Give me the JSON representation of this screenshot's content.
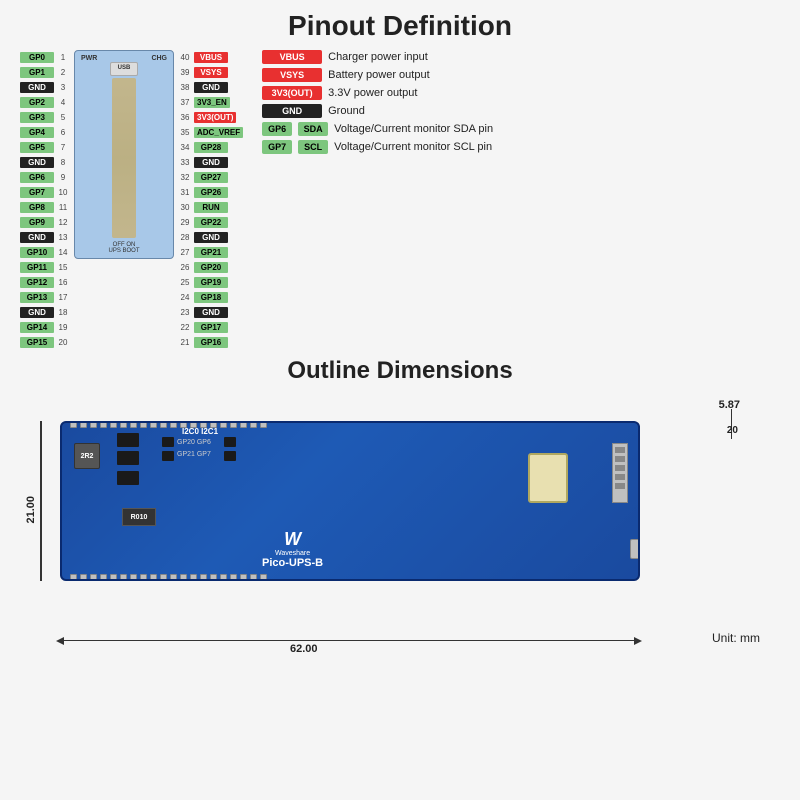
{
  "page": {
    "background": "#f0f0f0"
  },
  "pinout_section": {
    "title": "Pinout Definition",
    "left_pins": [
      {
        "label": "GP0",
        "num": "1",
        "type": "green"
      },
      {
        "label": "GP1",
        "num": "2",
        "type": "green"
      },
      {
        "label": "GND",
        "num": "3",
        "type": "black"
      },
      {
        "label": "GP2",
        "num": "4",
        "type": "green"
      },
      {
        "label": "GP3",
        "num": "5",
        "type": "green"
      },
      {
        "label": "GP4",
        "num": "6",
        "type": "green"
      },
      {
        "label": "GP5",
        "num": "7",
        "type": "green"
      },
      {
        "label": "GND",
        "num": "8",
        "type": "black"
      },
      {
        "label": "GP6",
        "num": "9",
        "type": "green"
      },
      {
        "label": "GP7",
        "num": "10",
        "type": "green"
      },
      {
        "label": "GP8",
        "num": "11",
        "type": "green"
      },
      {
        "label": "GP9",
        "num": "12",
        "type": "green"
      },
      {
        "label": "GND",
        "num": "13",
        "type": "black"
      },
      {
        "label": "GP10",
        "num": "14",
        "type": "green"
      },
      {
        "label": "GP11",
        "num": "15",
        "type": "green"
      },
      {
        "label": "GP12",
        "num": "16",
        "type": "green"
      },
      {
        "label": "GP13",
        "num": "17",
        "type": "green"
      },
      {
        "label": "GND",
        "num": "18",
        "type": "black"
      },
      {
        "label": "GP14",
        "num": "19",
        "type": "green"
      },
      {
        "label": "GP15",
        "num": "20",
        "type": "green"
      }
    ],
    "right_pins": [
      {
        "label": "VBUS",
        "num": "40",
        "type": "red"
      },
      {
        "label": "VSYS",
        "num": "39",
        "type": "red"
      },
      {
        "label": "GND",
        "num": "38",
        "type": "black"
      },
      {
        "label": "3V3_EN",
        "num": "37",
        "type": "green"
      },
      {
        "label": "3V3(OUT)",
        "num": "36",
        "type": "red"
      },
      {
        "label": "ADC_VREF",
        "num": "35",
        "type": "green"
      },
      {
        "label": "GP28",
        "num": "34",
        "type": "green"
      },
      {
        "label": "GND",
        "num": "33",
        "type": "black"
      },
      {
        "label": "GP27",
        "num": "32",
        "type": "green"
      },
      {
        "label": "GP26",
        "num": "31",
        "type": "green"
      },
      {
        "label": "RUN",
        "num": "30",
        "type": "green"
      },
      {
        "label": "GP22",
        "num": "29",
        "type": "green"
      },
      {
        "label": "GND",
        "num": "28",
        "type": "black"
      },
      {
        "label": "GP21",
        "num": "27",
        "type": "green"
      },
      {
        "label": "GP20",
        "num": "26",
        "type": "green"
      },
      {
        "label": "GP19",
        "num": "25",
        "type": "green"
      },
      {
        "label": "GP18",
        "num": "24",
        "type": "green"
      },
      {
        "label": "GND",
        "num": "23",
        "type": "black"
      },
      {
        "label": "GP17",
        "num": "22",
        "type": "green"
      },
      {
        "label": "GP16",
        "num": "21",
        "type": "green"
      }
    ],
    "legend": [
      {
        "chip": "VBUS",
        "chip_type": "red",
        "desc": "Charger power input"
      },
      {
        "chip": "VSYS",
        "chip_type": "red",
        "desc": "Battery power output"
      },
      {
        "chip": "3V3(OUT)",
        "chip_type": "red",
        "desc": "3.3V power output"
      },
      {
        "chip": "GND",
        "chip_type": "black",
        "desc": "Ground"
      },
      {
        "chip_left": "GP6",
        "chip_mid": "SDA",
        "chip_type": "green_pair",
        "desc": "Voltage/Current monitor SDA pin"
      },
      {
        "chip_left": "GP7",
        "chip_mid": "SCL",
        "chip_type": "green_pair",
        "desc": "Voltage/Current monitor SCL pin"
      }
    ]
  },
  "outline_section": {
    "title": "Outline Dimensions",
    "dim_width": "62.00",
    "dim_height": "21.00",
    "dim_small": "5.87",
    "dim_right_side": "20",
    "unit_label": "Unit: mm",
    "board_labels": {
      "i2c": "I2C0  I2C1",
      "gp_row1": "GP20   GP6",
      "gp_row2": "GP21   GP7",
      "waveshare": "Waveshare",
      "model": "Pico-UPS-B",
      "inductor": "2R2",
      "resistor": "R010"
    }
  }
}
